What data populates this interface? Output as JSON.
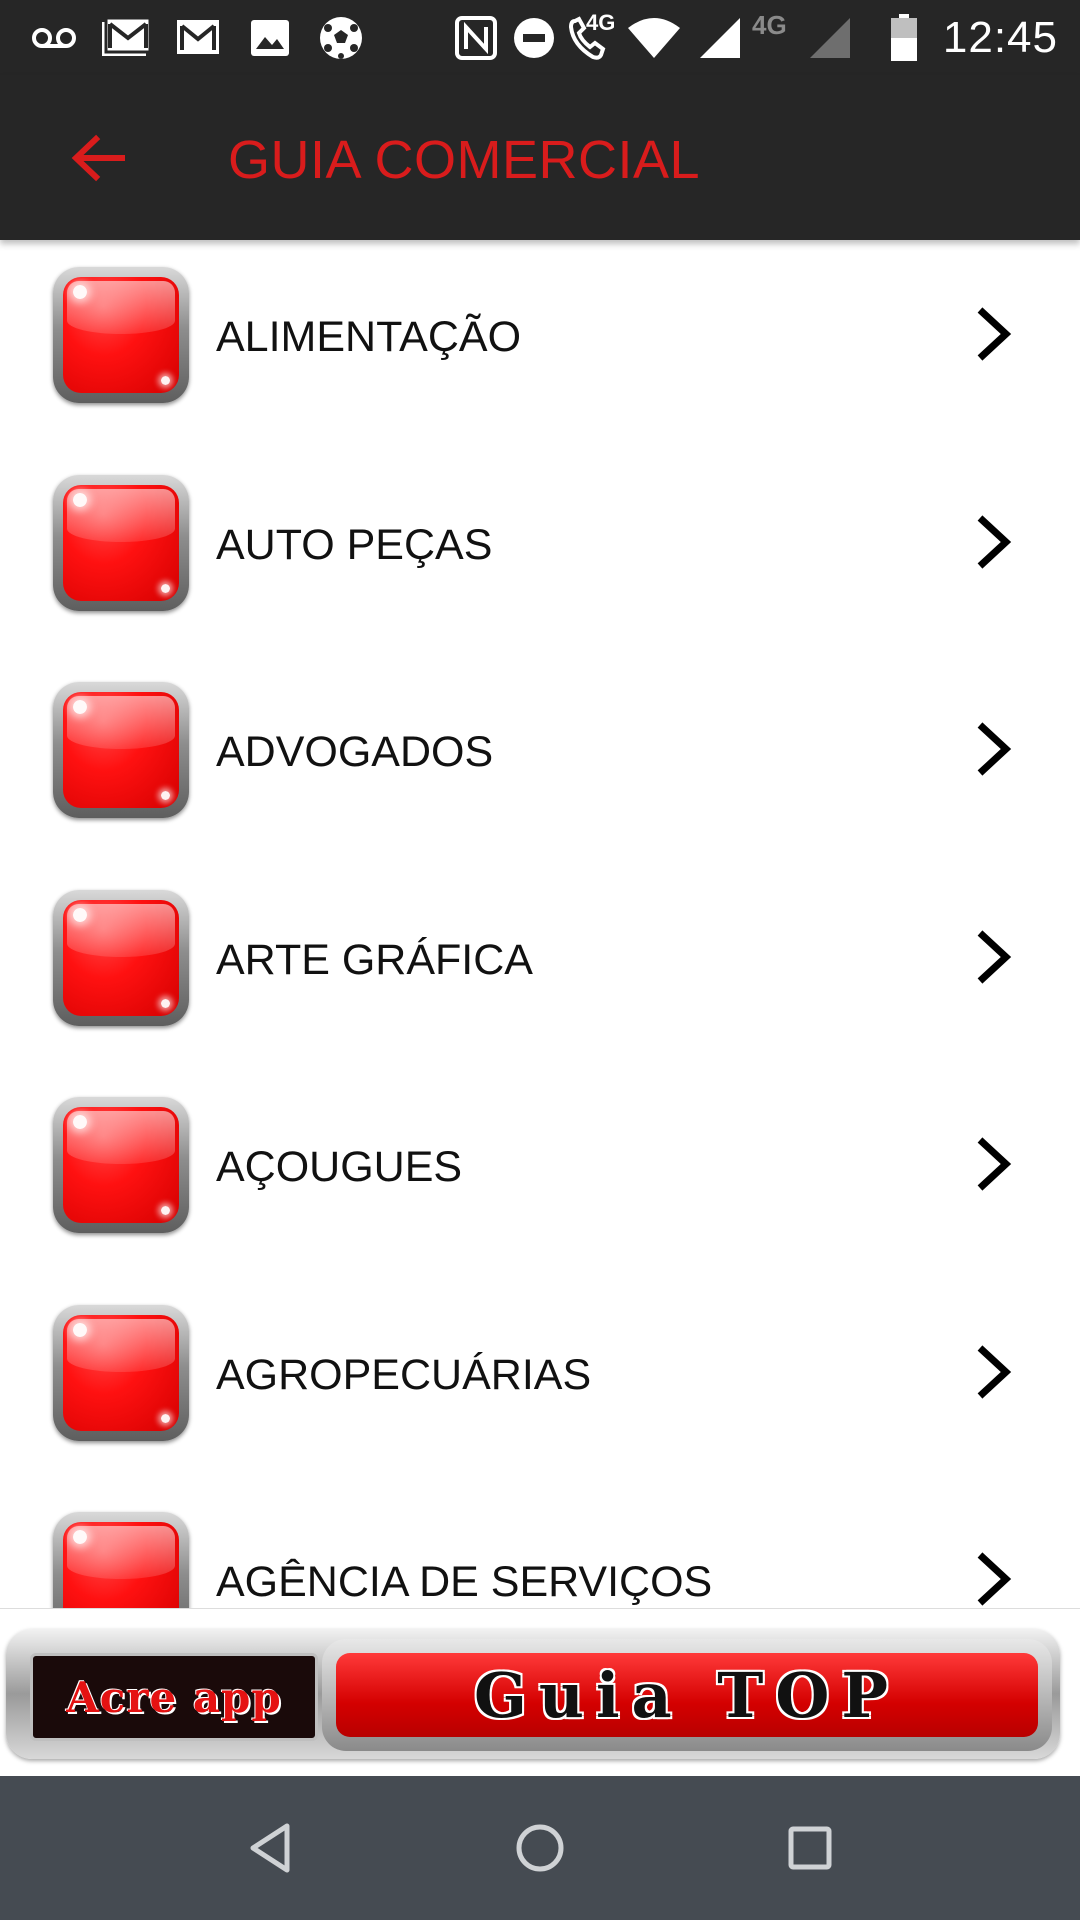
{
  "status_bar": {
    "time": "12:45",
    "network_label_1": "4G",
    "network_label_2": "4G",
    "icons": [
      "voicemail-icon",
      "gmail-icon",
      "gmail-icon",
      "image-icon",
      "soccer-ball-icon",
      "nfc-icon",
      "do-not-disturb-icon",
      "wifi-calling-icon",
      "wifi-icon",
      "signal-icon",
      "signal-icon",
      "battery-icon"
    ]
  },
  "app_bar": {
    "title": "GUIA COMERCIAL",
    "back_icon": "arrow-left-icon",
    "accent_color": "#d91c1c",
    "background_color": "#262626"
  },
  "list": {
    "items": [
      {
        "label": "ALIMENTAÇÃO"
      },
      {
        "label": "AUTO PEÇAS"
      },
      {
        "label": "ADVOGADOS"
      },
      {
        "label": "ARTE GRÁFICA"
      },
      {
        "label": "AÇOUGUES"
      },
      {
        "label": "AGROPECUÁRIAS"
      },
      {
        "label": "AGÊNCIA DE SERVIÇOS"
      }
    ],
    "chevron_icon": "chevron-right-icon"
  },
  "ad_banner": {
    "left_text": "Acre app",
    "right_text": "Guia TOP"
  },
  "nav_bar": {
    "buttons": [
      "back-triangle-icon",
      "home-circle-icon",
      "recents-square-icon"
    ]
  }
}
